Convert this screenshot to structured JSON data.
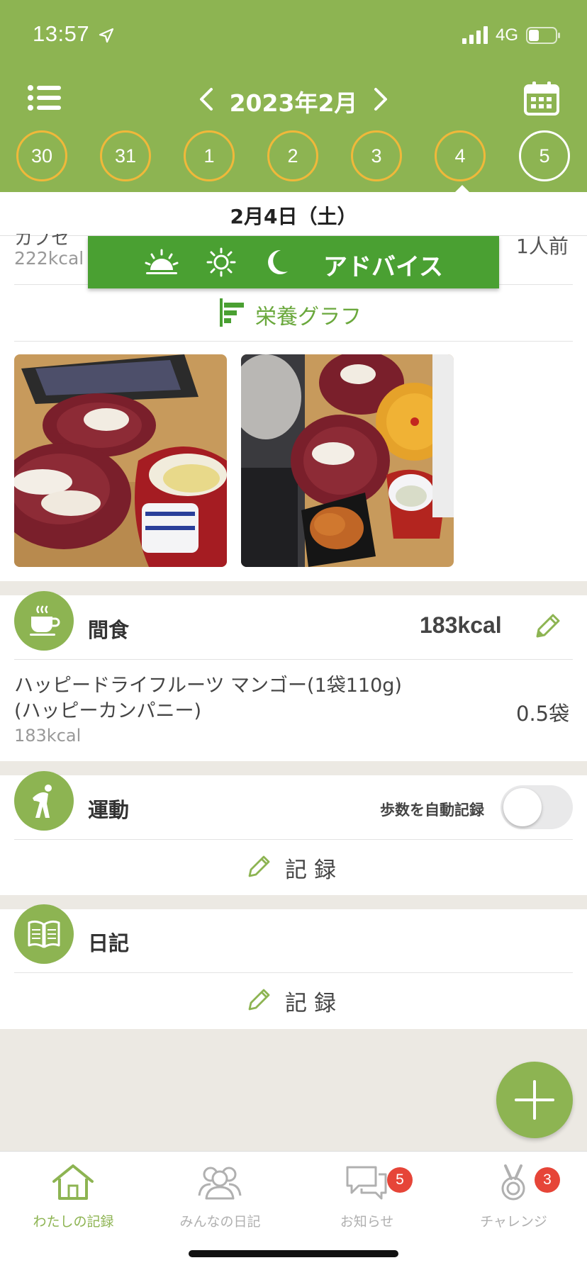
{
  "status_bar": {
    "time": "13:57",
    "network": "4G"
  },
  "header": {
    "month": "2023年2月",
    "days": [
      "30",
      "31",
      "1",
      "2",
      "3",
      "4",
      "5"
    ],
    "selected_date": "2月4日（土）"
  },
  "colors": {
    "brand": "#8db452",
    "advice": "#4aa032",
    "ring": "#f0b83a",
    "badge": "#e64538"
  },
  "meal_item_partial": {
    "name": "カプセ",
    "kcal": "222kcal",
    "quantity": "1人前"
  },
  "advice": {
    "label": "アドバイス",
    "icons": [
      "sunrise-icon",
      "sun-icon",
      "moon-icon"
    ]
  },
  "nutrition_graph": {
    "label": "栄養グラフ"
  },
  "photos": [
    "sushi-photo-1",
    "sushi-photo-2"
  ],
  "snack": {
    "title": "間食",
    "total_kcal": "183kcal",
    "items": [
      {
        "name_line1": "ハッピードライフルーツ マンゴー(1袋110g)",
        "name_line2": "(ハッピーカンパニー)",
        "kcal": "183kcal",
        "quantity": "0.5袋"
      }
    ]
  },
  "exercise": {
    "title": "運動",
    "auto_steps_label": "歩数を自動記録",
    "auto_steps_on": false,
    "record_label": "記録"
  },
  "diary": {
    "title": "日記",
    "record_label": "記録"
  },
  "bottom_nav": {
    "tabs": [
      {
        "label": "わたしの記録",
        "icon": "home-icon",
        "active": true
      },
      {
        "label": "みんなの日記",
        "icon": "people-icon",
        "active": false
      },
      {
        "label": "お知らせ",
        "icon": "chat-icon",
        "badge": "5",
        "active": false
      },
      {
        "label": "チャレンジ",
        "icon": "medal-icon",
        "badge": "3",
        "active": false
      }
    ]
  }
}
